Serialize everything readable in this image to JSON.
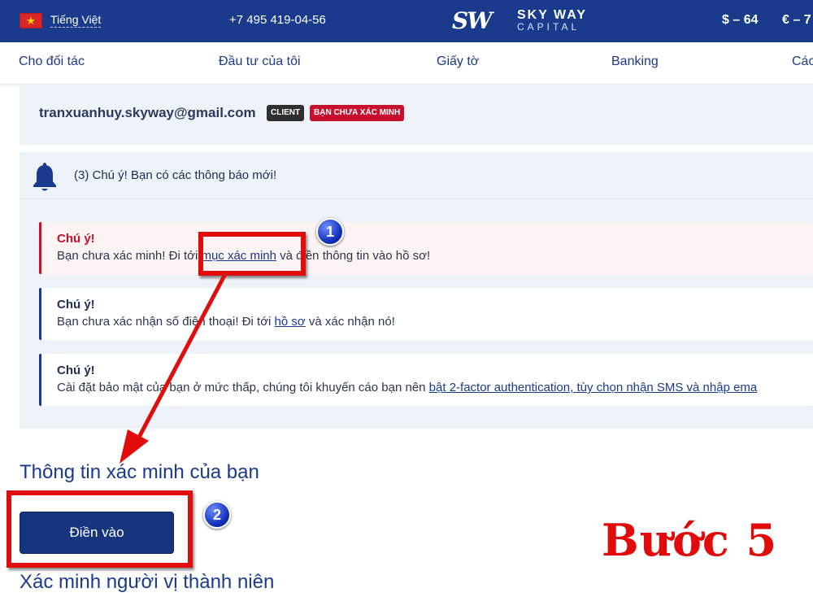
{
  "topbar": {
    "language": "Tiếng Việt",
    "phone": "+7 495 419-04-56",
    "logo": {
      "mark": "SW",
      "text": "SKY WAY",
      "sub": "CAPITAL"
    },
    "rate_usd": "$ – 64",
    "rate_eur": "€ – 7"
  },
  "nav": {
    "items": [
      {
        "label": "Cho đối tác"
      },
      {
        "label": "Đầu tư của tôi"
      },
      {
        "label": "Giấy tờ"
      },
      {
        "label": "Banking"
      },
      {
        "label": "Các"
      }
    ]
  },
  "account": {
    "email": "tranxuanhuy.skyway@gmail.com",
    "badge_client": "CLIENT",
    "badge_unverified": "BẠN CHƯA XÁC MINH"
  },
  "notifications": {
    "title": "(3) Chú ý! Bạn có các thông báo mới!",
    "alerts": [
      {
        "title": "Chú ý!",
        "before": "Bạn chưa xác minh! Đi tới ",
        "link": "mục xác minh",
        "after": " và điền thông tin vào hồ sơ!"
      },
      {
        "title": "Chú ý!",
        "before": "Bạn chưa xác nhận số điện thoại! Đi tới ",
        "link": "hồ sơ",
        "after": " và xác nhận nó!"
      },
      {
        "title": "Chú ý!",
        "before": "Cài đặt bảo mật của bạn ở mức thấp, chúng tôi khuyến cáo bạn nên ",
        "link": "bật 2-factor authentication, tùy chọn nhận SMS và nhập ema",
        "after": ""
      }
    ]
  },
  "verification": {
    "title": "Thông tin xác minh của bạn",
    "button": "Điền vào",
    "minor_title": "Xác minh người vị thành niên"
  },
  "annotations": {
    "badge_1": "1",
    "badge_2": "2",
    "step": "Bước 5",
    "color": "#e10d0d"
  },
  "colors": {
    "primary": "#1a3a8c",
    "danger": "#c8102e",
    "panel": "#eef2f9"
  }
}
